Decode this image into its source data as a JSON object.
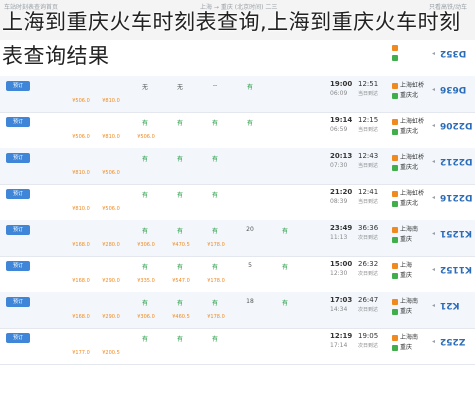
{
  "header": {
    "left": "车站时刻表查询首页",
    "mid": "上海 → 重庆 (北京时间) 二三",
    "right": "只看高铁/动车"
  },
  "overlay_title": "上海到重庆火车时刻表查询,上海到重庆火车时刻表查询结果",
  "book_label": "预订",
  "rows": [
    {
      "train": "D352",
      "dep": "",
      "dep_time": "",
      "arr": "",
      "arr_time": "",
      "dur": "",
      "dur_note": "",
      "seats": [],
      "prices": []
    },
    {
      "train": "D636",
      "dep": "上海虹桥",
      "dep_time": "06:09",
      "arr": "重庆北",
      "arr_time": "19:00",
      "dur": "12:51",
      "dur_note": "当日到达",
      "seats": [
        "无",
        "无",
        "--",
        "有"
      ],
      "prices": [
        "¥506.0",
        "¥810.0"
      ]
    },
    {
      "train": "D2206",
      "dep": "上海虹桥",
      "dep_time": "06:59",
      "arr": "重庆北",
      "arr_time": "19:14",
      "dur": "12:15",
      "dur_note": "当日到达",
      "seats": [
        "有",
        "有",
        "有",
        "有"
      ],
      "prices": [
        "¥506.0",
        "¥810.0",
        "¥506.0"
      ]
    },
    {
      "train": "D2212",
      "dep": "上海虹桥",
      "dep_time": "07:30",
      "arr": "重庆北",
      "arr_time": "20:13",
      "dur": "12:43",
      "dur_note": "当日到达",
      "seats": [
        "有",
        "有",
        "有"
      ],
      "prices": [
        "¥810.0",
        "¥506.0"
      ]
    },
    {
      "train": "D2216",
      "dep": "上海虹桥",
      "dep_time": "08:39",
      "arr": "重庆北",
      "arr_time": "21:20",
      "dur": "12:41",
      "dur_note": "当日到达",
      "seats": [
        "有",
        "有",
        "有"
      ],
      "prices": [
        "¥810.0",
        "¥506.0"
      ]
    },
    {
      "train": "K1251",
      "dep": "上海南",
      "dep_time": "11:13",
      "arr": "重庆",
      "arr_time": "23:49",
      "dur": "36:36",
      "dur_note": "次日到达",
      "seats": [
        "有",
        "有",
        "有",
        "20",
        "有"
      ],
      "prices": [
        "¥168.0",
        "¥280.0",
        "¥306.0",
        "¥470.5",
        "¥178.0"
      ]
    },
    {
      "train": "K1152",
      "dep": "上海",
      "dep_time": "12:30",
      "arr": "重庆",
      "arr_time": "15:00",
      "dur": "26:32",
      "dur_note": "次日到达",
      "seats": [
        "有",
        "有",
        "有",
        "5",
        "有"
      ],
      "prices": [
        "¥168.0",
        "¥290.0",
        "¥335.0",
        "¥547.0",
        "¥178.0"
      ]
    },
    {
      "train": "K21",
      "dep": "上海南",
      "dep_time": "14:34",
      "arr": "重庆",
      "arr_time": "17:03",
      "dur": "26:47",
      "dur_note": "次日到达",
      "seats": [
        "有",
        "有",
        "有",
        "18",
        "有"
      ],
      "prices": [
        "¥168.0",
        "¥290.0",
        "¥306.0",
        "¥460.5",
        "¥178.0"
      ]
    },
    {
      "train": "Z252",
      "dep": "上海南",
      "dep_time": "17:14",
      "arr": "重庆",
      "arr_time": "12:19",
      "dur": "19:05",
      "dur_note": "次日到达",
      "seats": [
        "有",
        "有",
        "有"
      ],
      "prices": [
        "¥177.0",
        "¥200.5"
      ]
    }
  ]
}
